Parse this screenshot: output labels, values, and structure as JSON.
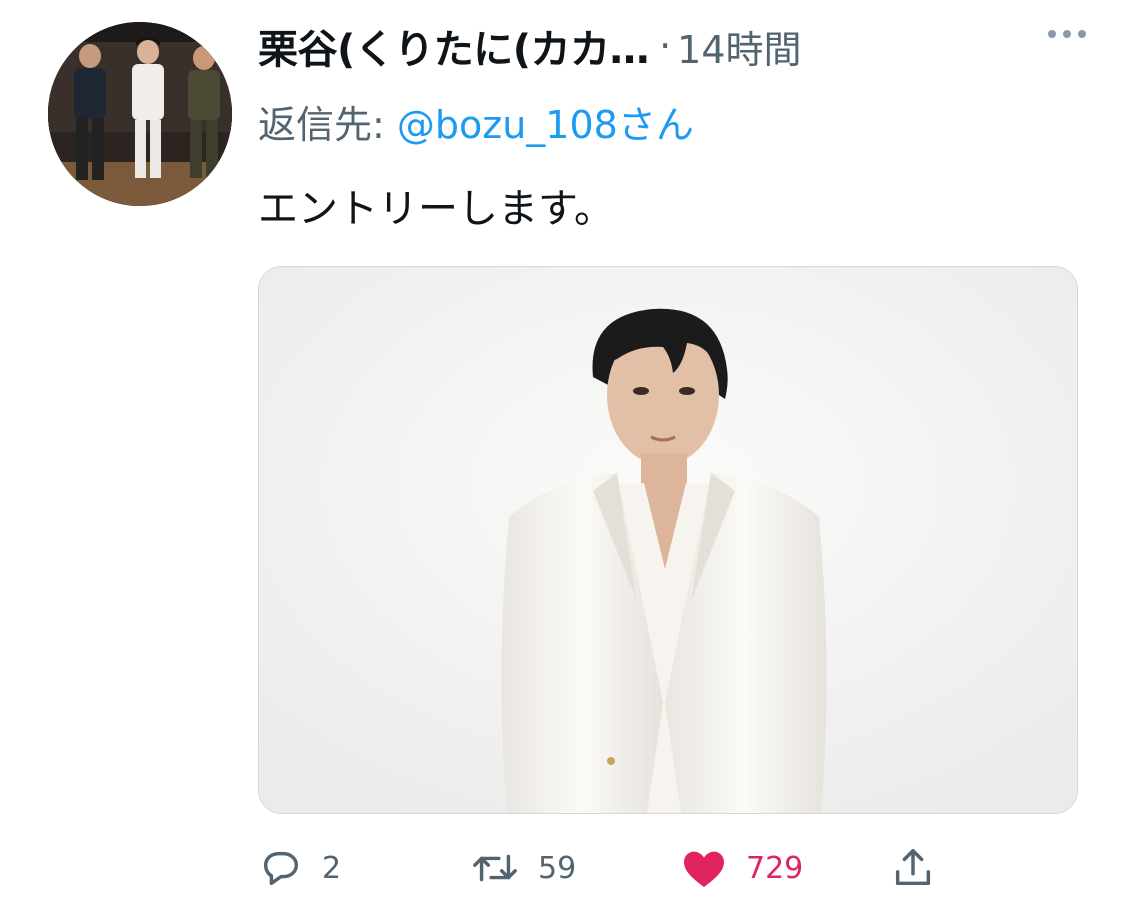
{
  "tweet": {
    "display_name": "栗谷(くりたに(カカ…",
    "separator": "·",
    "time": "14時間",
    "reply_prefix": "返信先:",
    "reply_handle": "@bozu_108さん",
    "text": "エントリーします。"
  },
  "actions": {
    "reply_count": "2",
    "retweet_count": "59",
    "like_count": "729"
  },
  "icons": {
    "more": "more-horizontal-icon",
    "reply": "reply-bubble-icon",
    "retweet": "retweet-icon",
    "like": "heart-icon",
    "share": "share-icon"
  },
  "colors": {
    "text_primary": "#0f1419",
    "text_secondary": "#536471",
    "link": "#1d9bf0",
    "like": "#e0245e"
  }
}
